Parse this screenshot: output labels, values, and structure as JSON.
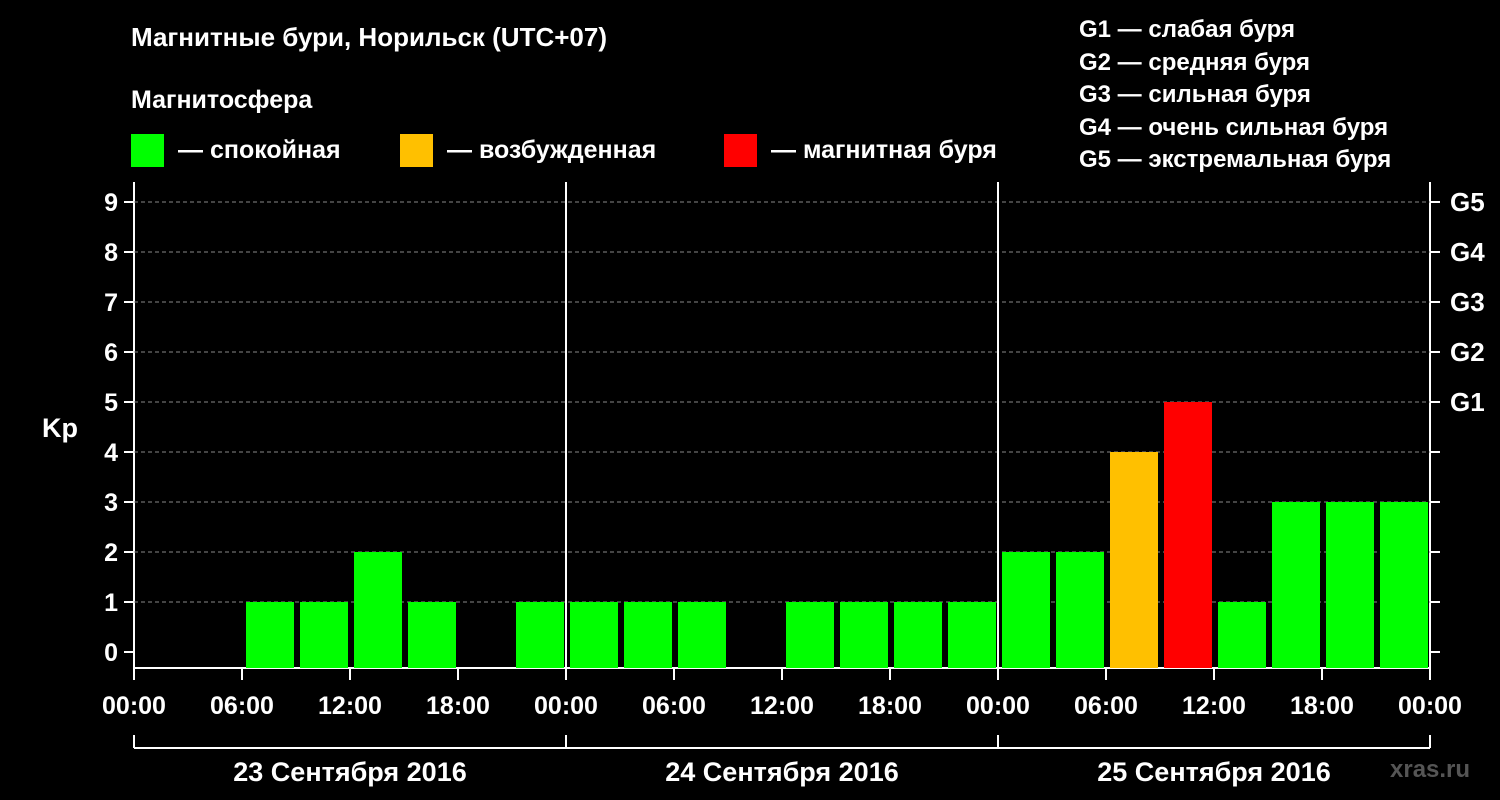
{
  "title": "Магнитные бури, Норильск (UTC+07)",
  "subtitle": "Магнитосфера",
  "legend": [
    {
      "label": "— спокойная",
      "color": "#00ff00"
    },
    {
      "label": "— возбужденная",
      "color": "#ffc000"
    },
    {
      "label": "— магнитная буря",
      "color": "#ff0000"
    }
  ],
  "g_legend": [
    "G1 — слабая буря",
    "G2 — средняя буря",
    "G3 — сильная буря",
    "G4 — очень сильная буря",
    "G5 — экстремальная буря"
  ],
  "watermark": "xras.ru",
  "chart_data": {
    "type": "bar",
    "ylabel": "Kp",
    "ylim": [
      0,
      9
    ],
    "y_ticks": [
      "0",
      "1",
      "2",
      "3",
      "4",
      "5",
      "6",
      "7",
      "8",
      "9"
    ],
    "right_ticks": [
      {
        "kp": 5,
        "label": "G1"
      },
      {
        "kp": 6,
        "label": "G2"
      },
      {
        "kp": 7,
        "label": "G3"
      },
      {
        "kp": 8,
        "label": "G4"
      },
      {
        "kp": 9,
        "label": "G5"
      }
    ],
    "x_ticks": [
      "00:00",
      "06:00",
      "12:00",
      "18:00",
      "00:00",
      "06:00",
      "12:00",
      "18:00",
      "00:00",
      "06:00",
      "12:00",
      "18:00",
      "00:00"
    ],
    "days": [
      "23 Сентября 2016",
      "24 Сентября 2016",
      "25 Сентября 2016"
    ],
    "interval_hours": 3,
    "values": [
      0,
      0,
      1,
      1,
      2,
      1,
      0,
      1,
      1,
      1,
      1,
      0,
      1,
      1,
      1,
      1,
      2,
      2,
      4,
      5,
      1,
      3,
      3,
      3
    ],
    "colors": {
      "quiet": "#00ff00",
      "active": "#ffc000",
      "storm": "#ff0000"
    },
    "grid": true
  }
}
